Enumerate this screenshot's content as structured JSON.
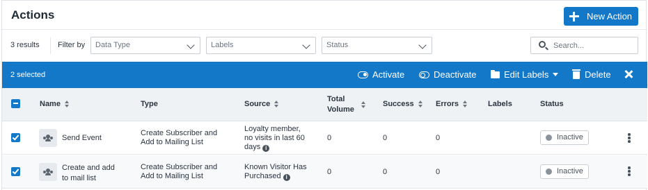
{
  "header": {
    "title": "Actions",
    "new_action_label": "New Action"
  },
  "filters": {
    "results_text": "3 results",
    "filter_by_label": "Filter by",
    "data_type_placeholder": "Data Type",
    "labels_placeholder": "Labels",
    "status_placeholder": "Status",
    "search_placeholder": "Search..."
  },
  "bulk_bar": {
    "selected_text": "2 selected",
    "activate_label": "Activate",
    "deactivate_label": "Deactivate",
    "edit_labels_label": "Edit Labels",
    "delete_label": "Delete",
    "background_color": "#1478c9"
  },
  "table": {
    "columns": {
      "name": "Name",
      "type": "Type",
      "source": "Source",
      "total_volume_line1": "Total",
      "total_volume_line2": "Volume",
      "success": "Success",
      "errors": "Errors",
      "labels": "Labels",
      "status": "Status"
    },
    "rows": [
      {
        "selected": true,
        "icon": "people-icon",
        "name_line1": "Send Event",
        "name_line2": "",
        "type_line1": "Create Subscriber and",
        "type_line2": "Add to Mailing List",
        "source_line1": "Loyalty member,",
        "source_line2": "no visits in last 60",
        "source_line3": "days",
        "total_volume": "0",
        "success": "0",
        "errors": "0",
        "labels": "",
        "status": "Inactive"
      },
      {
        "selected": true,
        "icon": "people-icon",
        "name_line1": "Create and add",
        "name_line2": "to mail list",
        "type_line1": "Create Subscriber and",
        "type_line2": "Add to Mailing List",
        "source_line1": "Known Visitor Has",
        "source_line2": "Purchased",
        "total_volume": "0",
        "success": "0",
        "errors": "0",
        "labels": "",
        "status": "Inactive"
      }
    ]
  }
}
